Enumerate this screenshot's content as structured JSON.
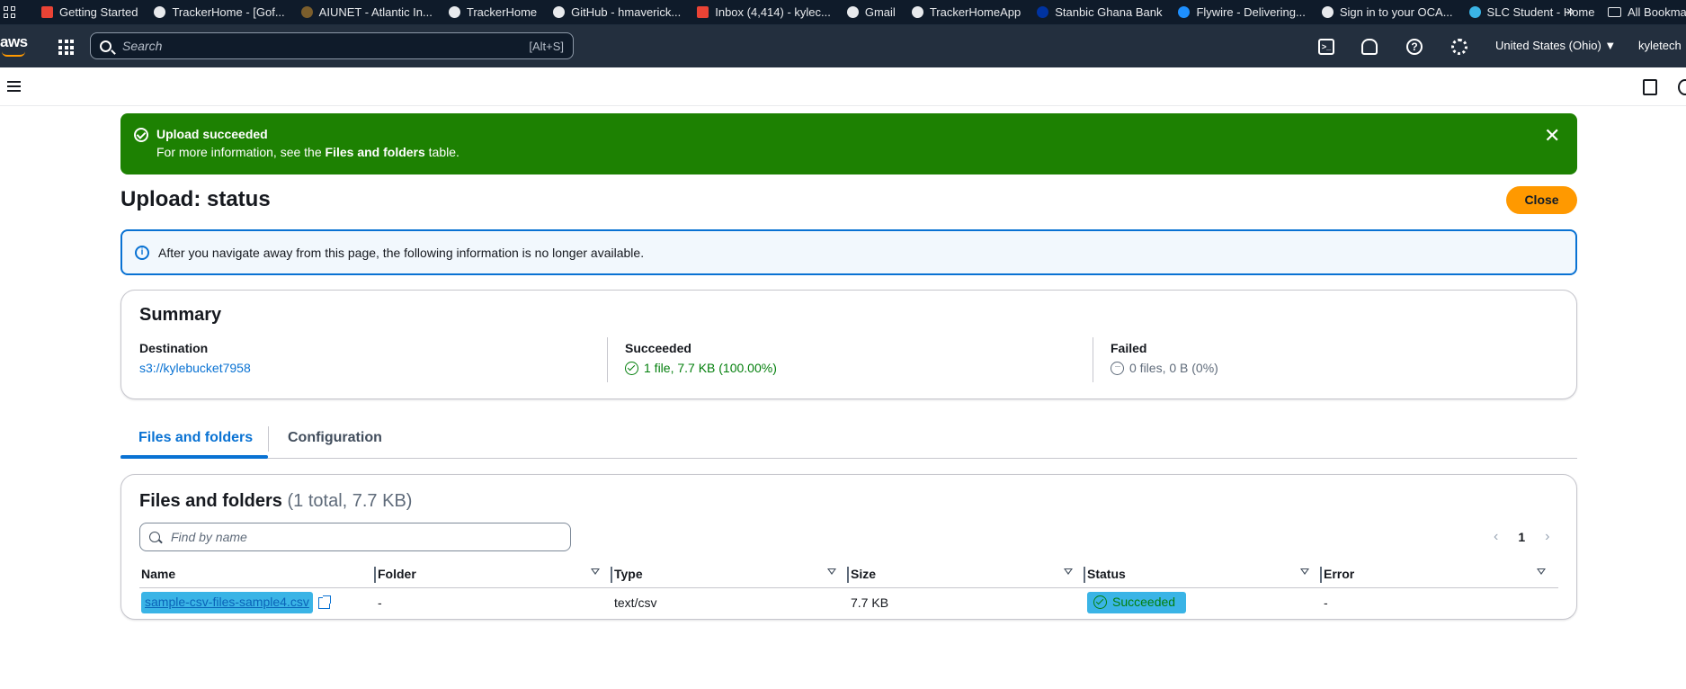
{
  "bookmarks": {
    "items": [
      {
        "label": "Getting Started",
        "icon": "gmail-icon",
        "color": "#ea4335"
      },
      {
        "label": "TrackerHome - [Gof...",
        "icon": "globe-icon",
        "color": "#e8eaed"
      },
      {
        "label": "AIUNET - Atlantic In...",
        "icon": "aiunet-icon",
        "color": "#7b5e2c"
      },
      {
        "label": "TrackerHome",
        "icon": "globe-icon",
        "color": "#e8eaed"
      },
      {
        "label": "GitHub - hmaverick...",
        "icon": "github-icon",
        "color": "#e8eaed"
      },
      {
        "label": "Inbox (4,414) - kylec...",
        "icon": "gmail-icon",
        "color": "#ea4335"
      },
      {
        "label": "Gmail",
        "icon": "globe-icon",
        "color": "#e8eaed"
      },
      {
        "label": "TrackerHomeApp",
        "icon": "globe-icon",
        "color": "#e8eaed"
      },
      {
        "label": "Stanbic Ghana Bank",
        "icon": "stanbic-icon",
        "color": "#0033a1"
      },
      {
        "label": "Flywire - Delivering...",
        "icon": "flywire-icon",
        "color": "#1e90ff"
      },
      {
        "label": "Sign in to your OCA...",
        "icon": "oc-icon",
        "color": "#e8eaed"
      },
      {
        "label": "SLC Student - Home",
        "icon": "slc-icon",
        "color": "#3ab4e6"
      }
    ],
    "all_label": "All Bookma"
  },
  "topnav": {
    "logo": "aws",
    "search_placeholder": "Search",
    "search_shortcut": "[Alt+S]",
    "region": "United States (Ohio) ▼",
    "account": "kyletech"
  },
  "flash": {
    "title": "Upload succeeded",
    "text_prefix": "For more information, see the ",
    "text_bold": "Files and folders",
    "text_suffix": " table.",
    "close": "✕"
  },
  "page": {
    "title": "Upload: status",
    "close_button": "Close"
  },
  "info": {
    "text": "After you navigate away from this page, the following information is no longer available."
  },
  "summary": {
    "title": "Summary",
    "destination_label": "Destination",
    "destination_value": "s3://kylebucket7958",
    "succeeded_label": "Succeeded",
    "succeeded_value": "1 file, 7.7 KB (100.00%)",
    "failed_label": "Failed",
    "failed_value": "0 files, 0 B (0%)"
  },
  "tabs": [
    {
      "label": "Files and folders",
      "active": true
    },
    {
      "label": "Configuration",
      "active": false
    }
  ],
  "files": {
    "title": "Files and folders",
    "count": "(1 total, 7.7 KB)",
    "filter_placeholder": "Find by name",
    "page": "1",
    "columns": [
      "Name",
      "Folder",
      "Type",
      "Size",
      "Status",
      "Error"
    ],
    "rows": [
      {
        "name": "sample-csv-files-sample4.csv",
        "folder": "-",
        "type": "text/csv",
        "size": "7.7 KB",
        "status": "Succeeded",
        "error": "-"
      }
    ]
  },
  "colors": {
    "success": "#1d8102",
    "primary_button": "#ff9900",
    "link": "#0972d3",
    "nav": "#232f3e",
    "highlight": "#3ab4e6"
  }
}
